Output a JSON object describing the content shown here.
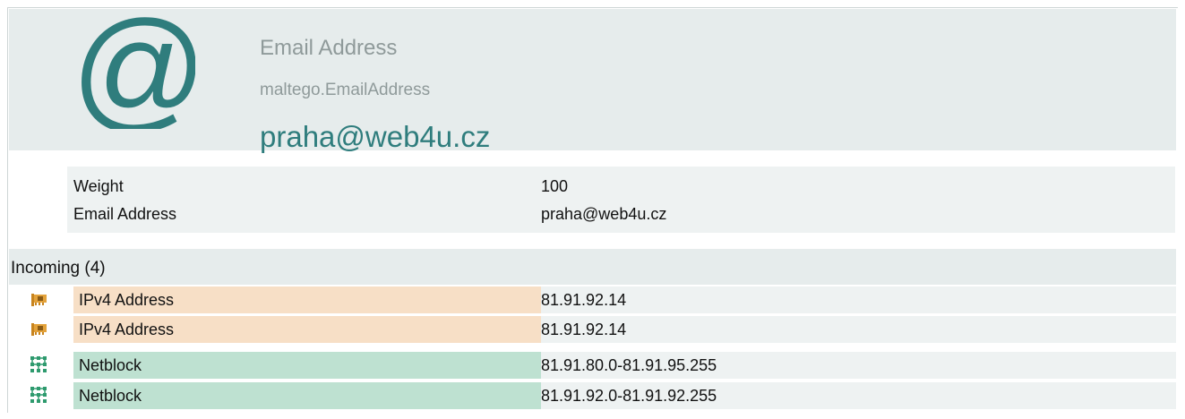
{
  "entity": {
    "type_name": "Email Address",
    "type_id": "maltego.EmailAddress",
    "value": "praha@web4u.cz",
    "icon": "at-sign-icon",
    "icon_color": "#2f7d7d"
  },
  "properties": [
    {
      "key": "Weight",
      "value": "100"
    },
    {
      "key": "Email Address",
      "value": "praha@web4u.cz"
    }
  ],
  "incoming": {
    "title": "Incoming (4)",
    "rows": [
      {
        "type": "IPv4 Address",
        "value": "81.91.92.14",
        "icon": "network-card-icon",
        "color": "#f7dfc6"
      },
      {
        "type": "IPv4 Address",
        "value": "81.91.92.14",
        "icon": "network-card-icon",
        "color": "#f7dfc6"
      },
      {
        "type": "Netblock",
        "value": "81.91.80.0-81.91.95.255",
        "icon": "netblock-grid-icon",
        "color": "#bee1d1"
      },
      {
        "type": "Netblock",
        "value": "81.91.92.0-81.91.92.255",
        "icon": "netblock-grid-icon",
        "color": "#bee1d1"
      }
    ]
  }
}
